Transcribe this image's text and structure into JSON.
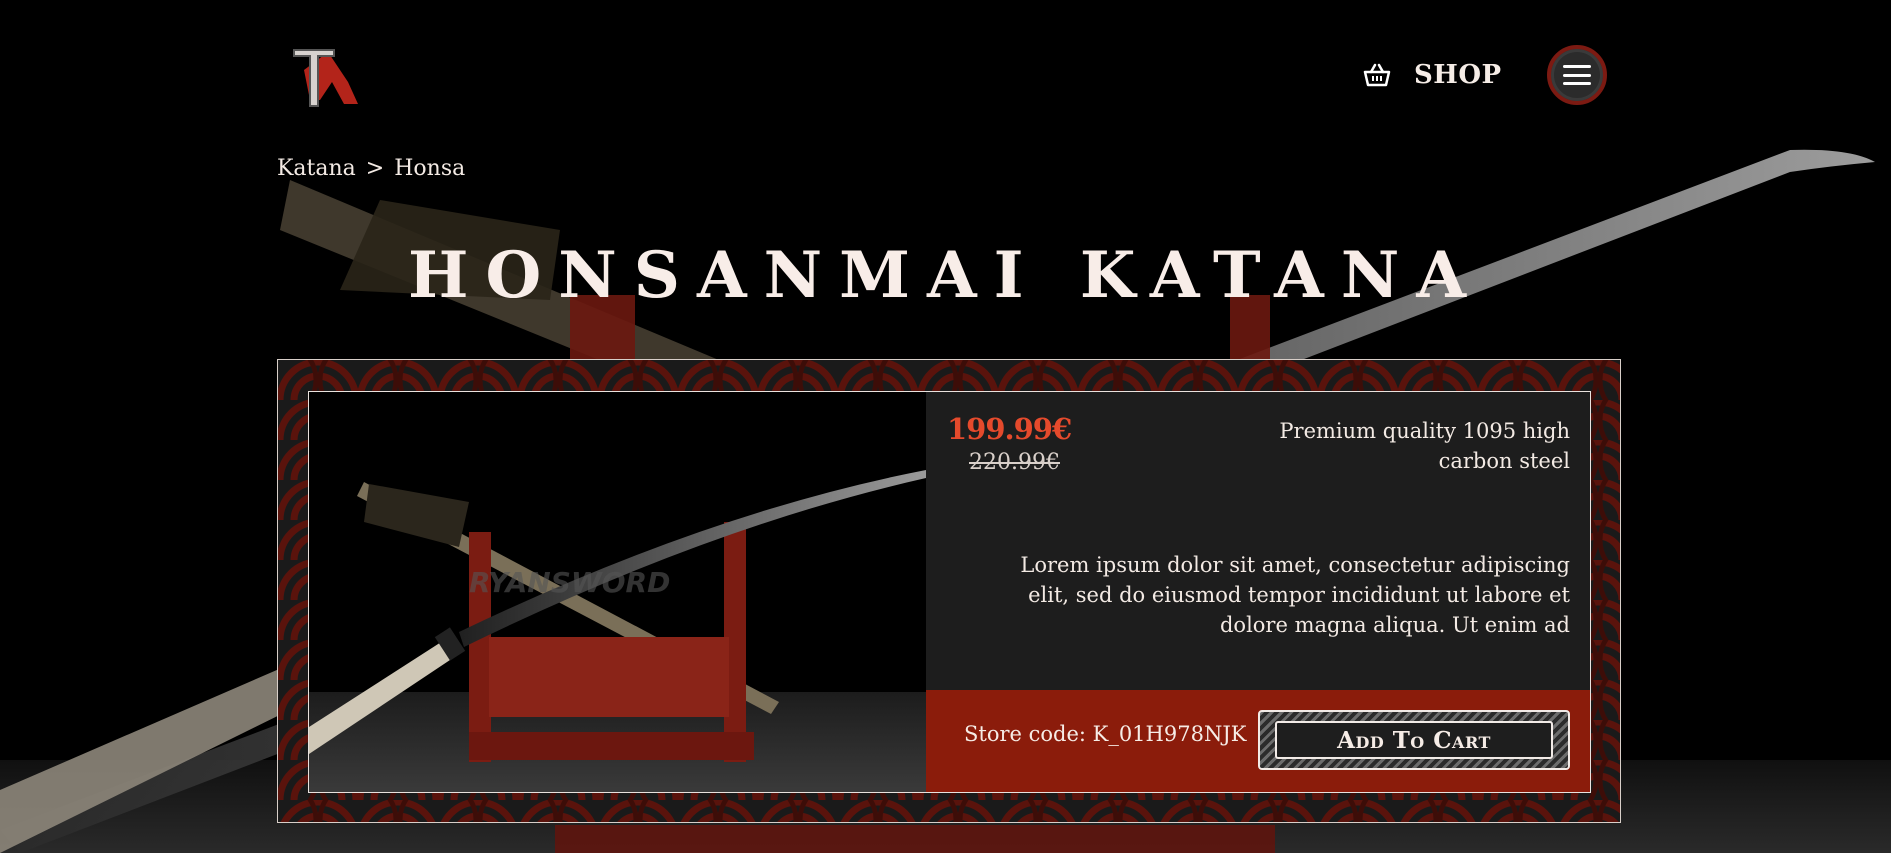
{
  "header": {
    "logo_icon": "tr-logo-icon",
    "shop_label": "SHOP",
    "shop_icon": "basket-icon",
    "menu_icon": "hamburger-menu-icon"
  },
  "breadcrumb": {
    "items": [
      "Katana",
      "Honsa"
    ],
    "separator": ">"
  },
  "product": {
    "title": "HONSANMAI KATANA",
    "price": "199.99€",
    "old_price": "220.99€",
    "feature": "Premium quality 1095 high carbon steel",
    "description": "Lorem ipsum dolor sit amet, consectetur adipiscing elit, sed do eiusmod tempor incididunt ut labore et dolore magna aliqua. Ut enim ad",
    "store_code": "Store code: K_01H978NJK",
    "add_to_cart_label": "Add To Cart",
    "image_watermark": "RYANSWORD"
  },
  "colors": {
    "accent_red": "#e54a2c",
    "bar_red": "#8b1c0b",
    "card_bg": "#1d1d1d",
    "page_bg": "#000000"
  }
}
